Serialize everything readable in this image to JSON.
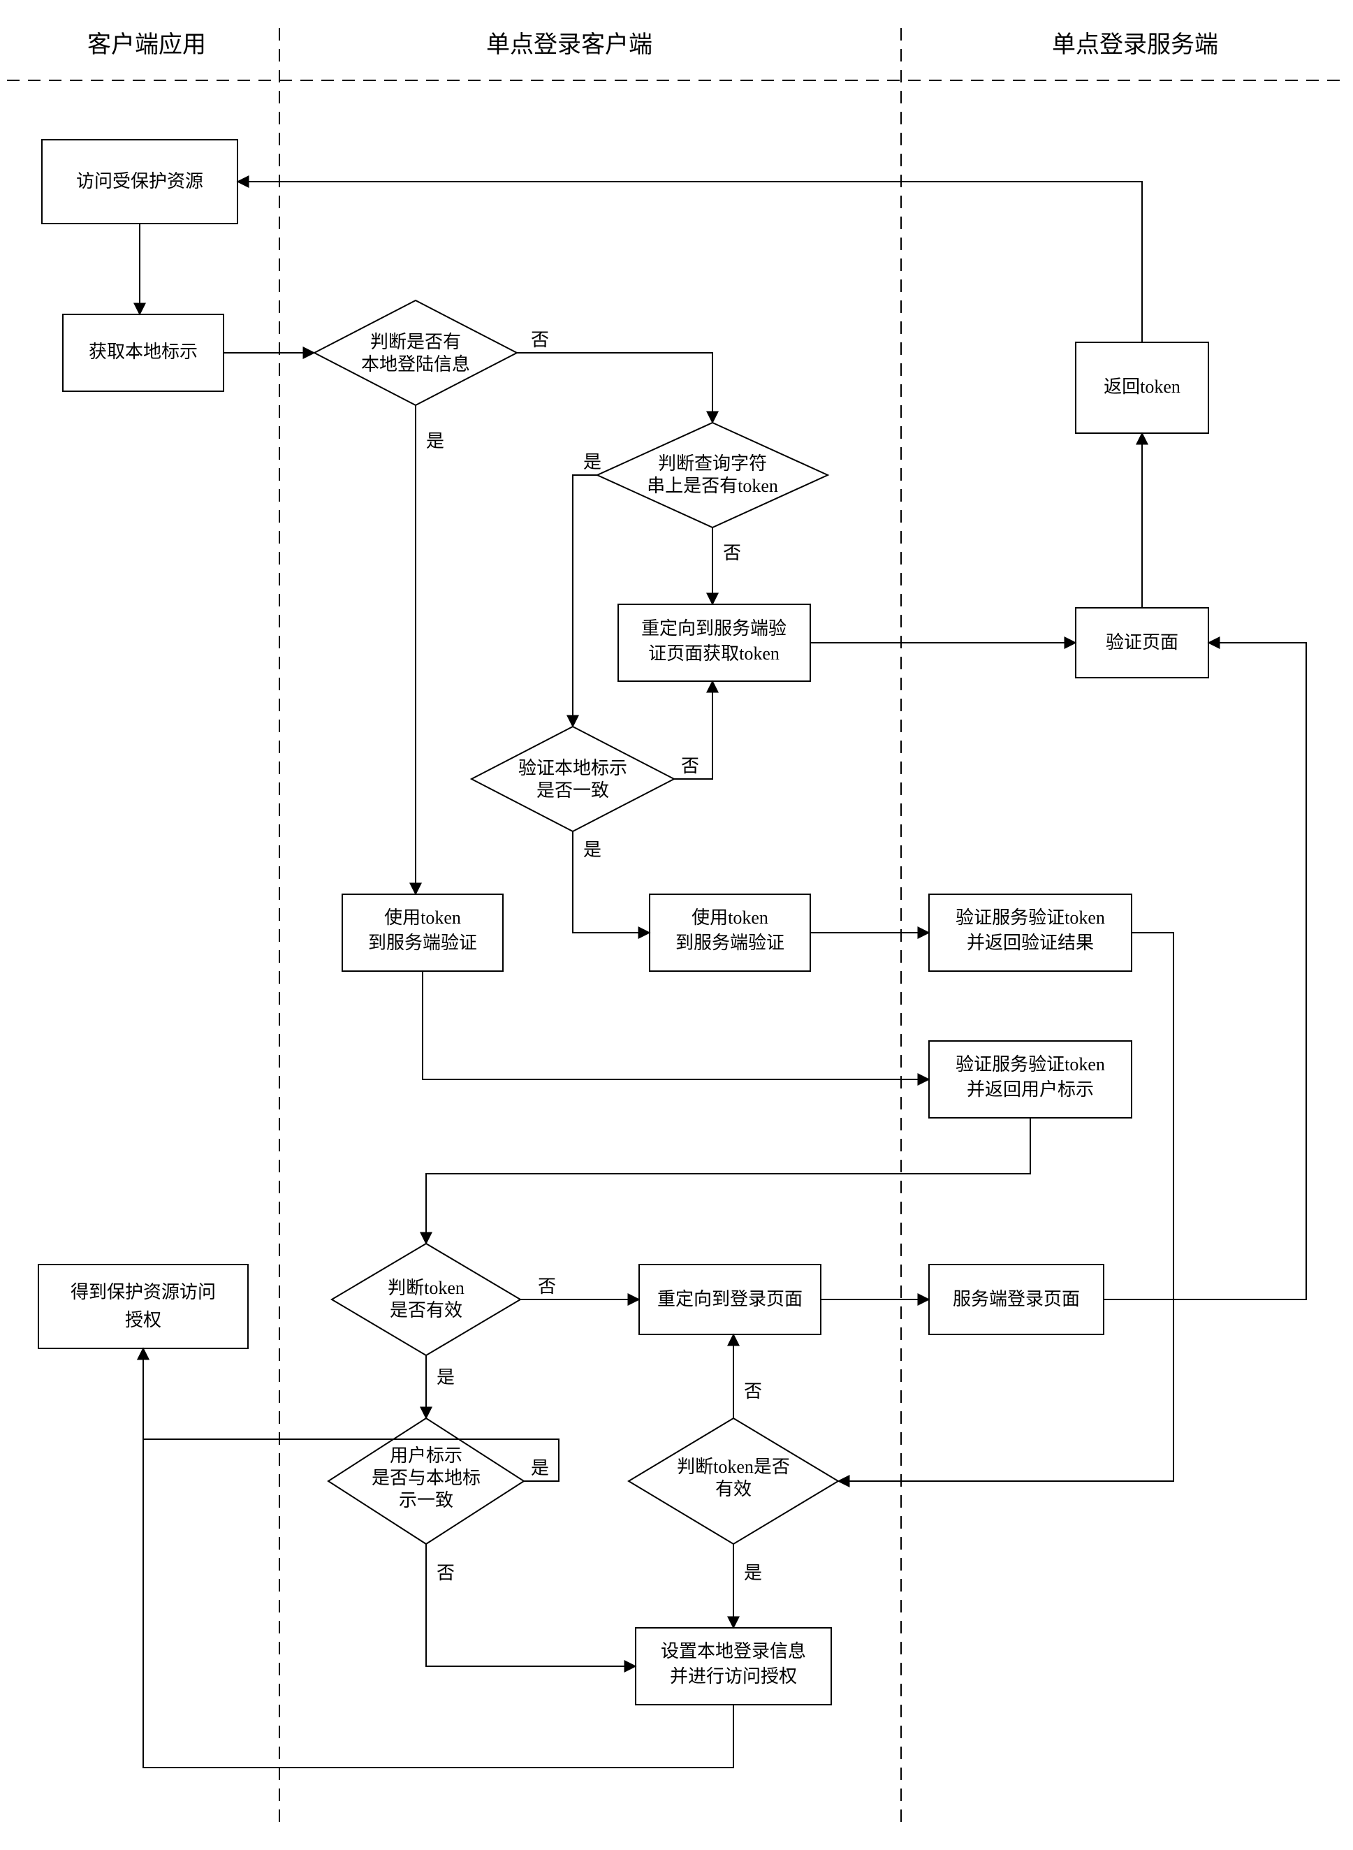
{
  "lanes": {
    "client_app": "客户端应用",
    "sso_client": "单点登录客户端",
    "sso_server": "单点登录服务端"
  },
  "nodes": {
    "access_protected_resource": "访问受保护资源",
    "get_local_identifier": "获取本地标示",
    "check_local_login_info": [
      "判断是否有",
      "本地登陆信息"
    ],
    "check_query_has_token": [
      "判断查询字符",
      "串上是否有token"
    ],
    "redirect_server_get_token": [
      "重定向到服务端验",
      "证页面获取token"
    ],
    "verify_local_id_consistent": [
      "验证本地标示",
      "是否一致"
    ],
    "use_token_verify_server_left": [
      "使用token",
      "到服务端验证"
    ],
    "use_token_verify_server_right": [
      "使用token",
      "到服务端验证"
    ],
    "verify_token_return_result": [
      "验证服务验证token",
      "并返回验证结果"
    ],
    "verify_token_return_user_id": [
      "验证服务验证token",
      "并返回用户标示"
    ],
    "check_token_valid_left": [
      "判断token",
      "是否有效"
    ],
    "grant_protected_access": [
      "得到保护资源访问",
      "授权"
    ],
    "redirect_login_page": "重定向到登录页面",
    "server_login_page": "服务端登录页面",
    "check_user_id_match_local": [
      "用户标示",
      "是否与本地标",
      "示一致"
    ],
    "check_token_valid_right": [
      "判断token是否",
      "有效"
    ],
    "set_local_login_and_authorize": [
      "设置本地登录信息",
      "并进行访问授权"
    ],
    "verify_page": "验证页面",
    "return_token": "返回token"
  },
  "labels": {
    "yes": "是",
    "no": "否"
  }
}
